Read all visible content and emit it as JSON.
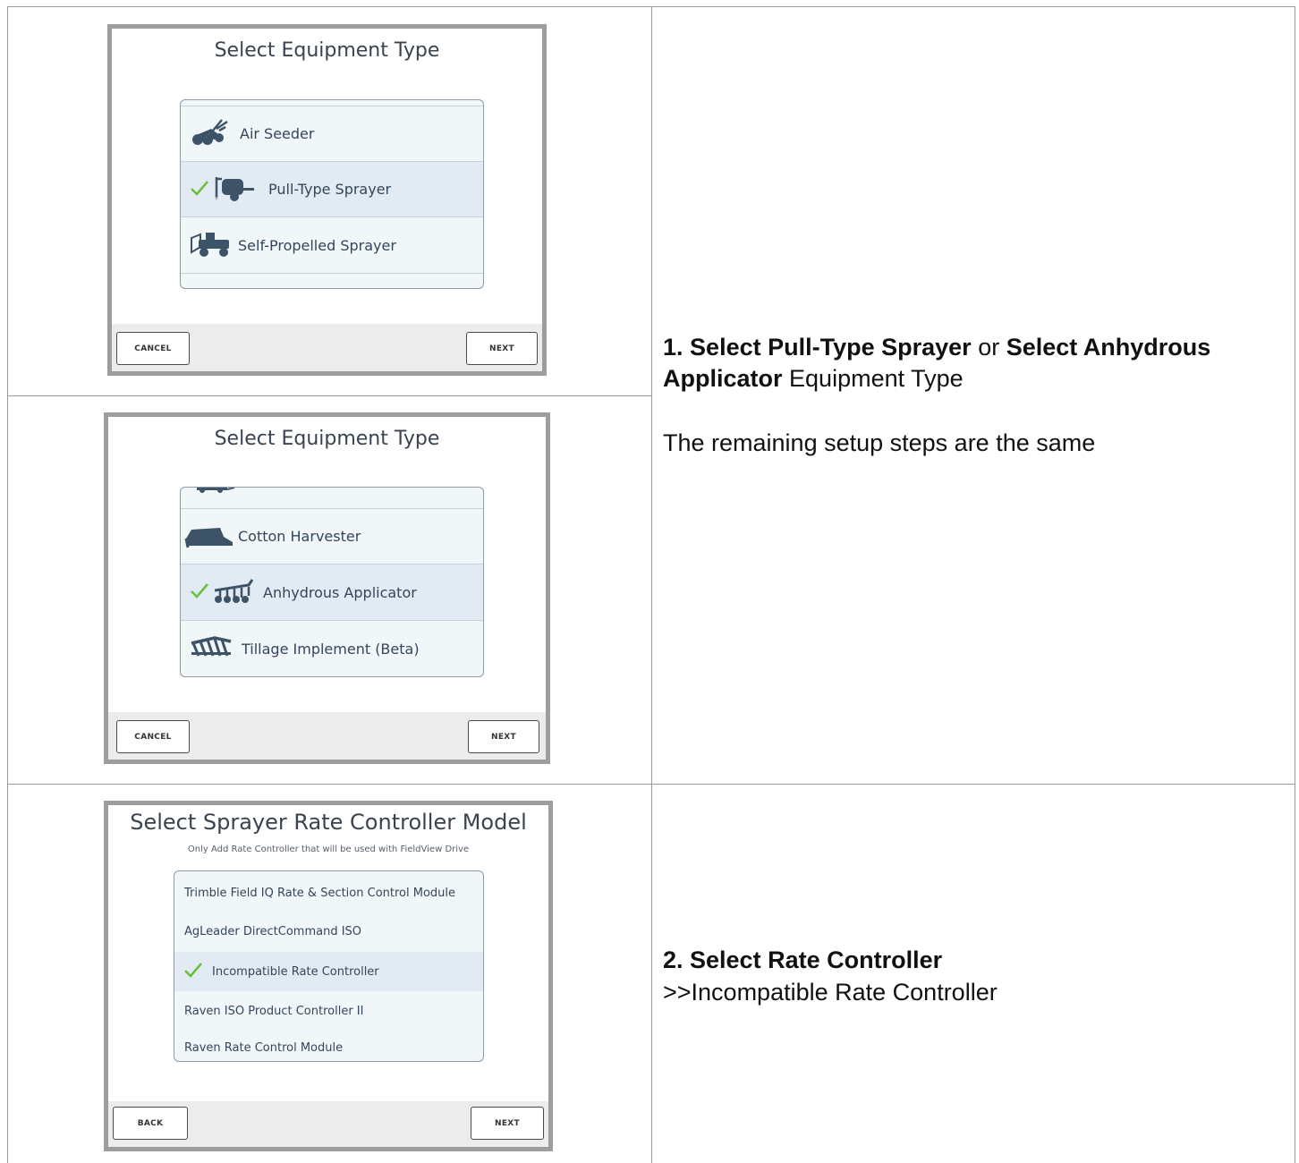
{
  "panel1": {
    "title": "Select Equipment Type",
    "items": [
      {
        "label": "Air Seeder",
        "icon": "air-seeder-icon",
        "selected": false
      },
      {
        "label": "Pull-Type Sprayer",
        "icon": "pull-type-sprayer-icon",
        "selected": true
      },
      {
        "label": "Self-Propelled Sprayer",
        "icon": "self-propelled-sprayer-icon",
        "selected": false
      }
    ],
    "cancel": "CANCEL",
    "next": "NEXT"
  },
  "panel2": {
    "title": "Select Equipment Type",
    "items": [
      {
        "label": "Cotton Harvester",
        "icon": "cotton-harvester-icon",
        "selected": false
      },
      {
        "label": "Anhydrous Applicator",
        "icon": "anhydrous-applicator-icon",
        "selected": true
      },
      {
        "label": "Tillage Implement (Beta)",
        "icon": "tillage-implement-icon",
        "selected": false
      }
    ],
    "cancel": "CANCEL",
    "next": "NEXT"
  },
  "panel3": {
    "title": "Select Sprayer Rate Controller Model",
    "subtitle": "Only Add Rate Controller that will be used with FieldView Drive",
    "items": [
      {
        "label": "Trimble Field IQ Rate & Section Control Module",
        "selected": false
      },
      {
        "label": "AgLeader DirectCommand ISO",
        "selected": false
      },
      {
        "label": "Incompatible Rate Controller",
        "selected": true
      },
      {
        "label": "Raven ISO Product Controller II",
        "selected": false
      },
      {
        "label": "Raven Rate Control Module",
        "selected": false
      }
    ],
    "back": "BACK",
    "next": "NEXT"
  },
  "step1": {
    "num": "1.",
    "b1": "Select Pull-Type Sprayer",
    "or": "or",
    "b2": "Select Anhydrous Applicator",
    "rest": "Equipment Type",
    "note": "The remaining setup steps are the same"
  },
  "step2": {
    "heading": "2. Select Rate Controller",
    "detail": ">>Incompatible Rate Controller"
  },
  "colors": {
    "checkmark": "#6cbf3a",
    "icon": "#3d5368",
    "selected_row": "#e2ebf3"
  }
}
